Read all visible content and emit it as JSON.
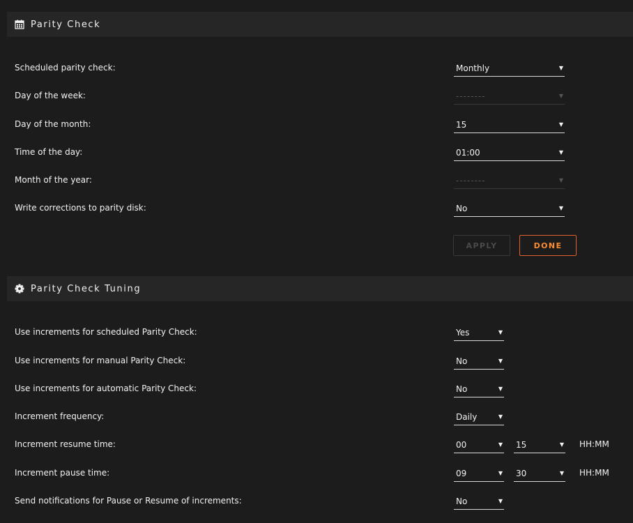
{
  "parity_check": {
    "title": "Parity Check",
    "icon": "calendar-icon",
    "rows": [
      {
        "label": "Scheduled parity check:",
        "value": "Monthly",
        "disabled": false
      },
      {
        "label": "Day of the week:",
        "value": "--------",
        "disabled": true
      },
      {
        "label": "Day of the month:",
        "value": "15",
        "disabled": false
      },
      {
        "label": "Time of the day:",
        "value": "01:00",
        "disabled": false
      },
      {
        "label": "Month of the year:",
        "value": "--------",
        "disabled": true
      },
      {
        "label": "Write corrections to parity disk:",
        "value": "No",
        "disabled": false
      }
    ],
    "apply_label": "APPLY",
    "done_label": "DONE"
  },
  "tuning": {
    "title": "Parity Check Tuning",
    "icon": "gear-icon",
    "rows": [
      {
        "label": "Use increments for scheduled Parity Check:",
        "value": "Yes"
      },
      {
        "label": "Use increments for manual Parity Check:",
        "value": "No"
      },
      {
        "label": "Use increments for automatic Parity Check:",
        "value": "No"
      },
      {
        "label": "Increment frequency:",
        "value": "Daily"
      },
      {
        "label": "Increment resume time:",
        "hour": "00",
        "minute": "15",
        "unit": "HH:MM"
      },
      {
        "label": "Increment pause time:",
        "hour": "09",
        "minute": "30",
        "unit": "HH:MM"
      },
      {
        "label": "Send notifications for Pause or Resume of increments:",
        "value": "No"
      }
    ]
  },
  "colors": {
    "background": "#1c1c1c",
    "header": "#262626",
    "accent": "#e0622a"
  }
}
